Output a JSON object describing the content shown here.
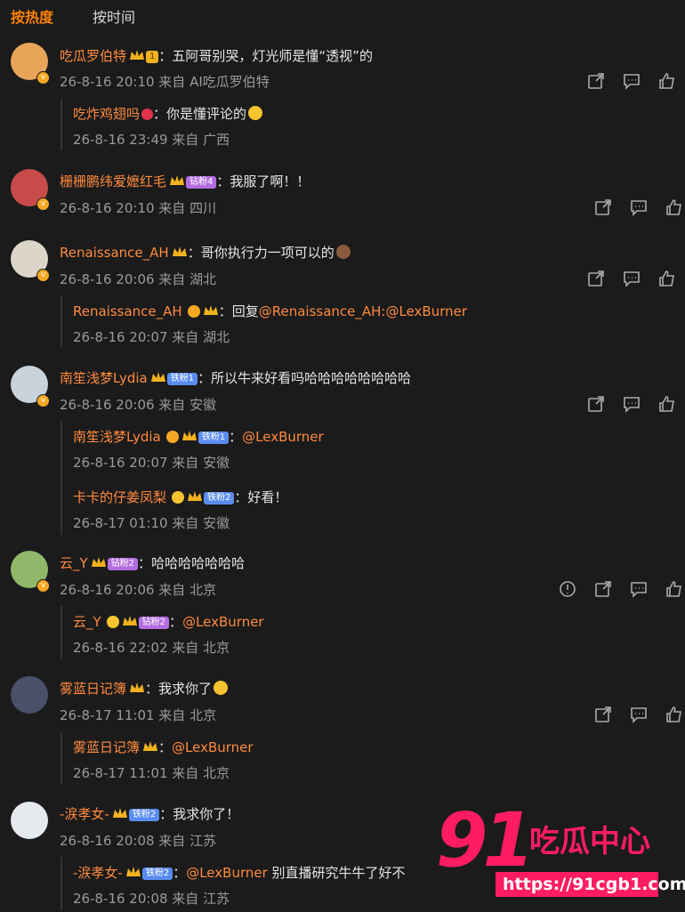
{
  "tabs": {
    "hot": "按热度",
    "time": "按时间"
  },
  "comments": [
    {
      "user": "吃瓜罗伯特",
      "fan_badge": "1",
      "text": "五阿哥别哭，灯光师是懂“透视”的",
      "meta": "26-8-16 20:10 来自 AI吃瓜罗伯特",
      "avatar_color": "#e8a55a",
      "replies": [
        {
          "user": "吃炸鸡翅吗",
          "text": "你是懂评论的",
          "meta": "26-8-16 23:49 来自 广西"
        }
      ]
    },
    {
      "user": "栅栅鹏纬爱嬷红毛",
      "fan_badge": "钻粉4",
      "text": "我服了啊！！",
      "meta": "26-8-16 20:10 来自 四川",
      "avatar_color": "#c94a4a",
      "replies": []
    },
    {
      "user": "Renaissance_AH",
      "text": "哥你执行力一项可以的",
      "meta": "26-8-16 20:06 来自 湖北",
      "avatar_color": "#dcd6c8",
      "replies": [
        {
          "user": "Renaissance_AH",
          "text": "回复",
          "mention": "@Renaissance_AH:@LexBurner",
          "meta": "26-8-16 20:07 来自 湖北"
        }
      ]
    },
    {
      "user": "南笙浅梦Lydia",
      "fan_badge": "铁粉1",
      "text": "所以牛来好看吗哈哈哈哈哈哈哈哈",
      "meta": "26-8-16 20:06 来自 安徽",
      "avatar_color": "#c9d3dc",
      "replies": [
        {
          "user": "南笙浅梦Lydia",
          "fan_badge": "铁粉1",
          "mention": "@LexBurner",
          "meta": "26-8-16 20:07 来自 安徽"
        },
        {
          "user": "卡卡的仔姜凤梨",
          "fan_badge": "铁粉2",
          "text": "好看！",
          "meta": "26-8-17 01:10 来自 安徽"
        }
      ]
    },
    {
      "user": "云_Y",
      "fan_badge": "钻粉2",
      "text": "哈哈哈哈哈哈哈",
      "meta": "26-8-16 20:06 来自 北京",
      "avatar_color": "#8fb86a",
      "replies": [
        {
          "user": "云_Y",
          "fan_badge": "钻粉2",
          "mention": "@LexBurner",
          "meta": "26-8-16 22:02 来自 北京"
        }
      ]
    },
    {
      "user": "雾蓝日记簿",
      "text": "我求你了",
      "meta": "26-8-17 11:01 来自 北京",
      "avatar_color": "#4a4f6a",
      "replies": [
        {
          "user": "雾蓝日记簿",
          "mention": "@LexBurner",
          "meta": "26-8-17 11:01 来自 北京"
        }
      ]
    },
    {
      "user": "-涙孝女-",
      "fan_badge": "铁粉2",
      "text": "我求你了！",
      "meta": "26-8-16 20:08 来自 江苏",
      "avatar_color": "#e6e9ee",
      "replies": [
        {
          "user": "-涙孝女-",
          "fan_badge": "铁粉2",
          "mention": "@LexBurner",
          "text": " 别直播研究牛牛了好不",
          "meta": "26-8-16 20:08 来自 江苏"
        }
      ]
    }
  ],
  "watermark": {
    "big": "91",
    "cn": "吃瓜中心",
    "url": "https://91cgb1.com"
  },
  "colors": {
    "accent": "#ff8200",
    "username": "#ff8a3d",
    "watermark": "#ff1c63"
  }
}
